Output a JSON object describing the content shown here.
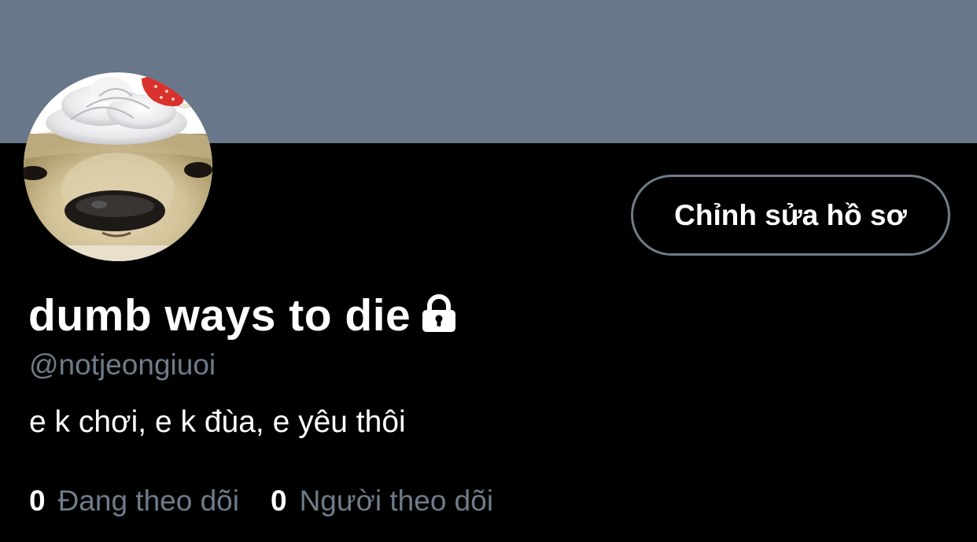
{
  "profile": {
    "display_name": "dumb ways to die",
    "protected_icon": "lock-icon",
    "handle": "@notjeongiuoi",
    "bio": "e k chơi, e k đùa, e yêu thôi",
    "avatar_description": "puppy-with-whipped-cream-avatar"
  },
  "actions": {
    "edit_profile_label": "Chỉnh sửa hồ sơ"
  },
  "stats": {
    "following_count": "0",
    "following_label": "Đang theo dõi",
    "followers_count": "0",
    "followers_label": "Người theo dõi"
  },
  "colors": {
    "banner": "#68778a",
    "background": "#000000",
    "secondary_text": "#6f7c89",
    "primary_text": "#ffffff"
  }
}
